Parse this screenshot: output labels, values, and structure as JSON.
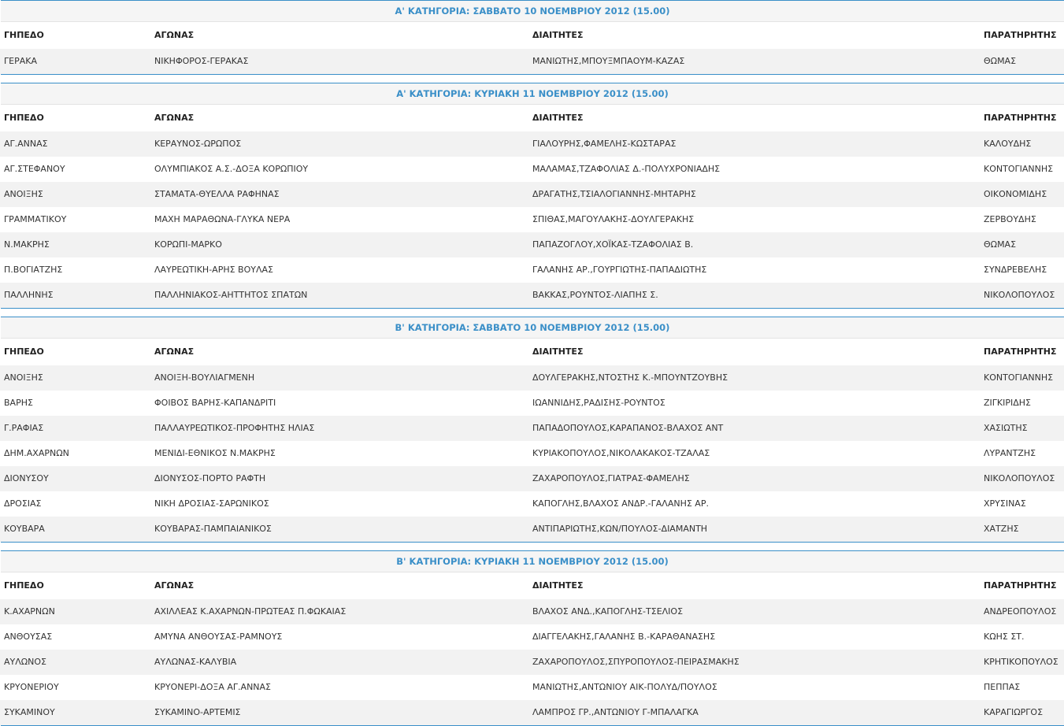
{
  "headers": {
    "stadium": "ΓΗΠΕΔΟ",
    "match": "ΑΓΩΝΑΣ",
    "referees": "ΔΙΑΙΤΗΤΕΣ",
    "observer": "ΠΑΡΑΤΗΡΗΤΗΣ"
  },
  "sections": [
    {
      "title": "Α' ΚΑΤΗΓΟΡΙΑ: ΣΑΒΒΑΤΟ 10 ΝΟΕΜΒΡΙΟΥ 2012 (15.00)",
      "rows": [
        [
          "ΓΕΡΑΚΑ",
          "ΝΙΚΗΦΟΡΟΣ-ΓΕΡΑΚΑΣ",
          "ΜΑΝΙΩΤΗΣ,ΜΠΟΥΞΜΠΑΟΥΜ-ΚΑΖΑΣ",
          "ΘΩΜΑΣ"
        ]
      ]
    },
    {
      "title": "Α' ΚΑΤΗΓΟΡΙΑ: ΚΥΡΙΑΚΗ 11 ΝΟΕΜΒΡΙΟΥ 2012 (15.00)",
      "rows": [
        [
          "ΑΓ.ΑΝΝΑΣ",
          "ΚΕΡΑΥΝΟΣ-ΩΡΩΠΟΣ",
          "ΓΙΑΛΟΥΡΗΣ,ΦΑΜΕΛΗΣ-ΚΩΣΤΑΡΑΣ",
          "ΚΑΛΟΥΔΗΣ"
        ],
        [
          "ΑΓ.ΣΤΕΦΑΝΟΥ",
          "ΟΛΥΜΠΙΑΚΟΣ Α.Σ.-ΔΟΞΑ ΚΟΡΩΠΙΟΥ",
          "ΜΑΛΑΜΑΣ,ΤΖΑΦΟΛΙΑΣ Δ.-ΠΟΛΥΧΡΟΝΙΑΔΗΣ",
          "ΚΟΝΤΟΓΙΑΝΝΗΣ"
        ],
        [
          "ΑΝΟΙΞΗΣ",
          "ΣΤΑΜΑΤΑ-ΘΥΕΛΛΑ ΡΑΦΗΝΑΣ",
          "ΔΡΑΓΑΤΗΣ,ΤΣΙΑΛΟΓΙΑΝΝΗΣ-ΜΗΤΑΡΗΣ",
          "ΟΙΚΟΝΟΜΙΔΗΣ"
        ],
        [
          "ΓΡΑΜΜΑΤΙΚΟΥ",
          "ΜΑΧΗ ΜΑΡΑΘΩΝΑ-ΓΛΥΚΑ ΝΕΡΑ",
          "ΣΠΙΘΑΣ,ΜΑΓΟΥΛΑΚΗΣ-ΔΟΥΛΓΕΡΑΚΗΣ",
          "ΖΕΡΒΟΥΔΗΣ"
        ],
        [
          "Ν.ΜΑΚΡΗΣ",
          "ΚΟΡΩΠΙ-ΜΑΡΚΟ",
          "ΠΑΠΑΖΟΓΛΟΥ,ΧΟΪΚΑΣ-ΤΖΑΦΟΛΙΑΣ Β.",
          "ΘΩΜΑΣ"
        ],
        [
          "Π.ΒΟΓΙΑΤΖΗΣ",
          "ΛΑΥΡΕΩΤΙΚΗ-ΑΡΗΣ ΒΟΥΛΑΣ",
          "ΓΑΛΑΝΗΣ ΑΡ.,ΓΟΥΡΓΙΩΤΗΣ-ΠΑΠΑΔΙΩΤΗΣ",
          "ΣΥΝΔΡΕΒΕΛΗΣ"
        ],
        [
          "ΠΑΛΛΗΝΗΣ",
          "ΠΑΛΛΗΝΙΑΚΟΣ-ΑΗΤΤΗΤΟΣ ΣΠΑΤΩΝ",
          "ΒΑΚΚΑΣ,ΡΟΥΝΤΟΣ-ΛΙΑΠΗΣ Σ.",
          "ΝΙΚΟΛΟΠΟΥΛΟΣ"
        ]
      ]
    },
    {
      "title": "Β' ΚΑΤΗΓΟΡΙΑ: ΣΑΒΒΑΤΟ 10 ΝΟΕΜΒΡΙΟΥ 2012 (15.00)",
      "rows": [
        [
          "ΑΝΟΙΞΗΣ",
          "ΑΝΟΙΞΗ-ΒΟΥΛΙΑΓΜΕΝΗ",
          "ΔΟΥΛΓΕΡΑΚΗΣ,ΝΤΟΣΤΗΣ Κ.-ΜΠΟΥΝΤΖΟΥΒΗΣ",
          "ΚΟΝΤΟΓΙΑΝΝΗΣ"
        ],
        [
          "ΒΑΡΗΣ",
          "ΦΟΙΒΟΣ ΒΑΡΗΣ-ΚΑΠΑΝΔΡΙΤΙ",
          "ΙΩΑΝΝΙΔΗΣ,ΡΑΔΙΣΗΣ-ΡΟΥΝΤΟΣ",
          "ΖΙΓΚΙΡΙΔΗΣ"
        ],
        [
          "Γ.ΡΑΦΙΑΣ",
          "ΠΑΛΛΑΥΡΕΩΤΙΚΟΣ-ΠΡΟΦΗΤΗΣ ΗΛΙΑΣ",
          "ΠΑΠΑΔΟΠΟΥΛΟΣ,ΚΑΡΑΠΑΝΟΣ-ΒΛΑΧΟΣ ΑΝΤ",
          "ΧΑΣΙΩΤΗΣ"
        ],
        [
          "ΔΗΜ.ΑΧΑΡΝΩΝ",
          "ΜΕΝΙΔΙ-ΕΘΝΙΚΟΣ Ν.ΜΑΚΡΗΣ",
          "ΚΥΡΙΑΚΟΠΟΥΛΟΣ,ΝΙΚΟΛΑΚΑΚΟΣ-ΤΖΑΛΑΣ",
          "ΛΥΡΑΝΤΖΗΣ"
        ],
        [
          "ΔΙΟΝΥΣΟΥ",
          "ΔΙΟΝΥΣΟΣ-ΠΟΡΤΟ ΡΑΦΤΗ",
          "ΖΑΧΑΡΟΠΟΥΛΟΣ,ΓΙΑΤΡΑΣ-ΦΑΜΕΛΗΣ",
          "ΝΙΚΟΛΟΠΟΥΛΟΣ"
        ],
        [
          "ΔΡΟΣΙΑΣ",
          "ΝΙΚΗ ΔΡΟΣΙΑΣ-ΣΑΡΩΝΙΚΟΣ",
          "ΚΑΠΟΓΛΗΣ,ΒΛΑΧΟΣ ΑΝΔΡ.-ΓΑΛΑΝΗΣ ΑΡ.",
          "ΧΡΥΣΙΝΑΣ"
        ],
        [
          "ΚΟΥΒΑΡΑ",
          "ΚΟΥΒΑΡΑΣ-ΠΑΜΠΑΙΑΝΙΚΟΣ",
          "ΑΝΤΙΠΑΡΙΩΤΗΣ,ΚΩΝ/ΠΟΥΛΟΣ-ΔΙΑΜΑΝΤΗ",
          "ΧΑΤΖΗΣ"
        ]
      ]
    },
    {
      "title": "Β' ΚΑΤΗΓΟΡΙΑ: ΚΥΡΙΑΚΗ 11 ΝΟΕΜΒΡΙΟΥ 2012 (15.00)",
      "rows": [
        [
          "Κ.ΑΧΑΡΝΩΝ",
          "ΑΧΙΛΛΕΑΣ Κ.ΑΧΑΡΝΩΝ-ΠΡΩΤΕΑΣ Π.ΦΩΚΑΙΑΣ",
          "ΒΛΑΧΟΣ ΑΝΔ.,ΚΑΠΟΓΛΗΣ-ΤΣΕΛΙΟΣ",
          "ΑΝΔΡΕΟΠΟΥΛΟΣ"
        ],
        [
          "ΑΝΘΟΥΣΑΣ",
          "ΑΜΥΝΑ ΑΝΘΟΥΣΑΣ-ΡΑΜΝΟΥΣ",
          "ΔΙΑΓΓΕΛΑΚΗΣ,ΓΑΛΑΝΗΣ Β.-ΚΑΡΑΘΑΝΑΣΗΣ",
          "ΚΩΗΣ ΣΤ."
        ],
        [
          "ΑΥΛΩΝΟΣ",
          "ΑΥΛΩΝΑΣ-ΚΑΛΥΒΙΑ",
          "ΖΑΧΑΡΟΠΟΥΛΟΣ,ΣΠΥΡΟΠΟΥΛΟΣ-ΠΕΙΡΑΣΜΑΚΗΣ",
          "ΚΡΗΤΙΚΟΠΟΥΛΟΣ"
        ],
        [
          "ΚΡΥΟΝΕΡΙΟΥ",
          "ΚΡΥΟΝΕΡΙ-ΔΟΞΑ ΑΓ.ΑΝΝΑΣ",
          "ΜΑΝΙΩΤΗΣ,ΑΝΤΩΝΙΟΥ ΑΙΚ-ΠΟΛΥΔ/ΠΟΥΛΟΣ",
          "ΠΕΠΠΑΣ"
        ],
        [
          "ΣΥΚΑΜΙΝΟΥ",
          "ΣΥΚΑΜΙΝΟ-ΑΡΤΕΜΙΣ",
          "ΛΑΜΠΡΟΣ ΓΡ.,ΑΝΤΩΝΙΟΥ Γ-ΜΠΑΛΑΓΚΑ",
          "ΚΑΡΑΓΙΩΡΓΟΣ"
        ]
      ]
    }
  ]
}
